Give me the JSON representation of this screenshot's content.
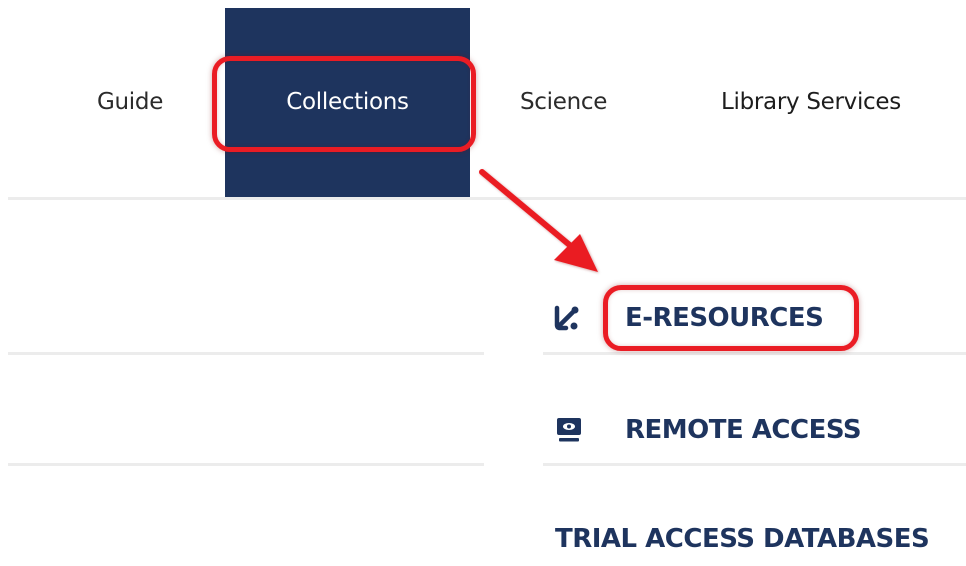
{
  "nav": {
    "items": [
      {
        "label": "Guide"
      },
      {
        "label": "Collections"
      },
      {
        "label": "Science"
      },
      {
        "label": "Library Services"
      }
    ],
    "active": "Collections"
  },
  "menu": {
    "items": [
      {
        "label": "E-RESOURCES",
        "icon": "connection-icon"
      },
      {
        "label": "REMOTE ACCESS",
        "icon": "monitor-icon"
      },
      {
        "label": "TRIAL ACCESS DATABASES"
      }
    ]
  },
  "colors": {
    "brand_navy": "#1e345e",
    "highlight_red": "#ea1c24",
    "divider": "#ececec"
  }
}
